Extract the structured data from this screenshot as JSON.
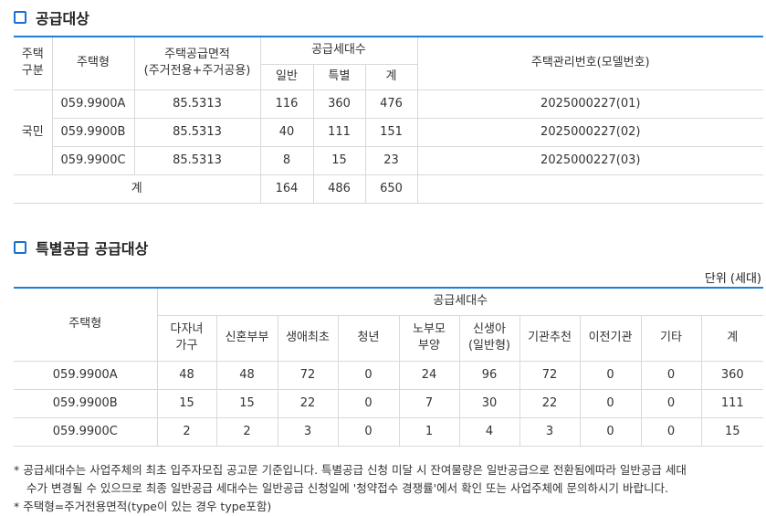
{
  "section1": {
    "title": "공급대상",
    "headers": {
      "type_category": "주택\n구분",
      "house_type": "주택형",
      "area": "주택공급면적\n(주거전용+주거공용)",
      "supply_units": "공급세대수",
      "general": "일반",
      "special": "특별",
      "total": "계",
      "model_no": "주택관리번호(모델번호)"
    },
    "category": "국민",
    "rows": [
      {
        "type": "059.9900A",
        "area": "85.5313",
        "general": "116",
        "special": "360",
        "total": "476",
        "model": "2025000227(01)"
      },
      {
        "type": "059.9900B",
        "area": "85.5313",
        "general": "40",
        "special": "111",
        "total": "151",
        "model": "2025000227(02)"
      },
      {
        "type": "059.9900C",
        "area": "85.5313",
        "general": "8",
        "special": "15",
        "total": "23",
        "model": "2025000227(03)"
      }
    ],
    "sum": {
      "label": "계",
      "general": "164",
      "special": "486",
      "total": "650"
    }
  },
  "section2": {
    "title": "특별공급 공급대상",
    "unit": "단위 (세대)",
    "headers": {
      "house_type": "주택형",
      "supply_units": "공급세대수",
      "cols": [
        "다자녀\n가구",
        "신혼부부",
        "생애최초",
        "청년",
        "노부모\n부양",
        "신생아\n(일반형)",
        "기관추천",
        "이전기관",
        "기타",
        "계"
      ]
    },
    "rows": [
      {
        "type": "059.9900A",
        "values": [
          "48",
          "48",
          "72",
          "0",
          "24",
          "96",
          "72",
          "0",
          "0",
          "360"
        ]
      },
      {
        "type": "059.9900B",
        "values": [
          "15",
          "15",
          "22",
          "0",
          "7",
          "30",
          "22",
          "0",
          "0",
          "111"
        ]
      },
      {
        "type": "059.9900C",
        "values": [
          "2",
          "2",
          "3",
          "0",
          "1",
          "4",
          "3",
          "0",
          "0",
          "15"
        ]
      }
    ]
  },
  "notes": [
    "* 공급세대수는 사업주체의 최초 입주자모집 공고문 기준입니다. 특별공급 신청 미달 시 잔여물량은 일반공급으로 전환됨에따라 일반공급 세대",
    "수가 변경될 수 있으므로 최종 일반공급 세대수는 일반공급 신청일에 '청약접수 경쟁률'에서 확인 또는 사업주체에 문의하시기 바랍니다.",
    "* 주택형=주거전용면적(type이 있는 경우 type포함)"
  ],
  "colors": {
    "accent": "#1e7fd6"
  }
}
